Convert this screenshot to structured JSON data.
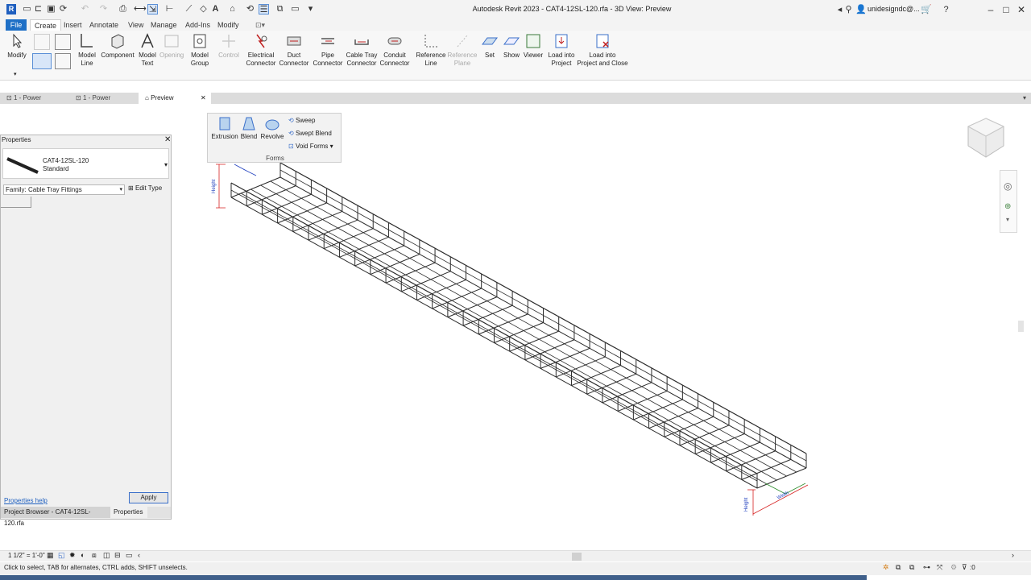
{
  "window": {
    "title": "Autodesk Revit 2023 - CAT4-12SL-120.rfa - 3D View: Preview",
    "user": "unidesigndc@...",
    "app_logo": "R"
  },
  "ribbon_tabs": [
    "File",
    "Create",
    "Insert",
    "Annotate",
    "View",
    "Manage",
    "Add-Ins",
    "Modify"
  ],
  "ribbon": {
    "modify": "Modify",
    "model_line": "Model\nLine",
    "component": "Component",
    "model_text": "Model\nText",
    "opening": "Opening",
    "model_group": "Model\nGroup",
    "control": "Control",
    "electrical_connector": "Electrical\nConnector",
    "duct_connector": "Duct\nConnector",
    "pipe_connector": "Pipe\nConnector",
    "cable_tray_connector": "Cable Tray\nConnector",
    "conduit_connector": "Conduit\nConnector",
    "reference_line": "Reference\nLine",
    "reference_plane": "Reference\nPlane",
    "set": "Set",
    "show": "Show",
    "viewer": "Viewer",
    "load_into_project": "Load into\nProject",
    "load_into_project_close": "Load into\nProject and Close"
  },
  "forms_panel": {
    "extrusion": "Extrusion",
    "blend": "Blend",
    "revolve": "Revolve",
    "sweep": "Sweep",
    "swept_blend": "Swept Blend",
    "void_forms": "Void  Forms",
    "label": "Forms"
  },
  "doc_tabs": [
    {
      "label": "1 - Power"
    },
    {
      "label": "1 - Power"
    },
    {
      "label": "Preview"
    }
  ],
  "properties": {
    "title": "Properties",
    "type_name": "CAT4-12SL-120",
    "type_sub": "Standard",
    "family": "Family: Cable Tray Fittings",
    "edit_type": "Edit Type",
    "help": "Properties help",
    "apply": "Apply",
    "tab_browser": "Project Browser - CAT4-12SL-120.rfa",
    "tab_properties": "Properties"
  },
  "view": {
    "scale": "1 1/2\" = 1'-0\"",
    "dim_height": "Height",
    "dim_width": "Width"
  },
  "status": {
    "text": "Click to select, TAB for alternates, CTRL adds, SHIFT unselects.",
    "filter_count": ":0"
  },
  "colors": {
    "accent": "#1e6fc6",
    "tray_stroke": "#2b2b2b",
    "dimension": "#d62020",
    "dimension_text": "#1f3fbf"
  }
}
